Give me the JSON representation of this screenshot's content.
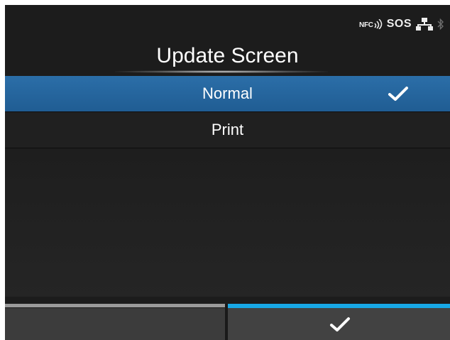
{
  "status": {
    "nfc_label": "NFC",
    "sos_label": "SOS",
    "icons": [
      "nfc-icon",
      "sos-icon",
      "network-icon",
      "bluetooth-icon"
    ]
  },
  "title": "Update Screen",
  "options": [
    {
      "label": "Normal",
      "selected": true
    },
    {
      "label": "Print",
      "selected": false
    }
  ],
  "softkeys": {
    "left": {
      "label": ""
    },
    "right": {
      "icon": "check-icon"
    }
  },
  "colors": {
    "selected_row": "#2467a0",
    "softkey_accent": "#18a8e6",
    "softkey_inactive": "#9a9a9a"
  }
}
